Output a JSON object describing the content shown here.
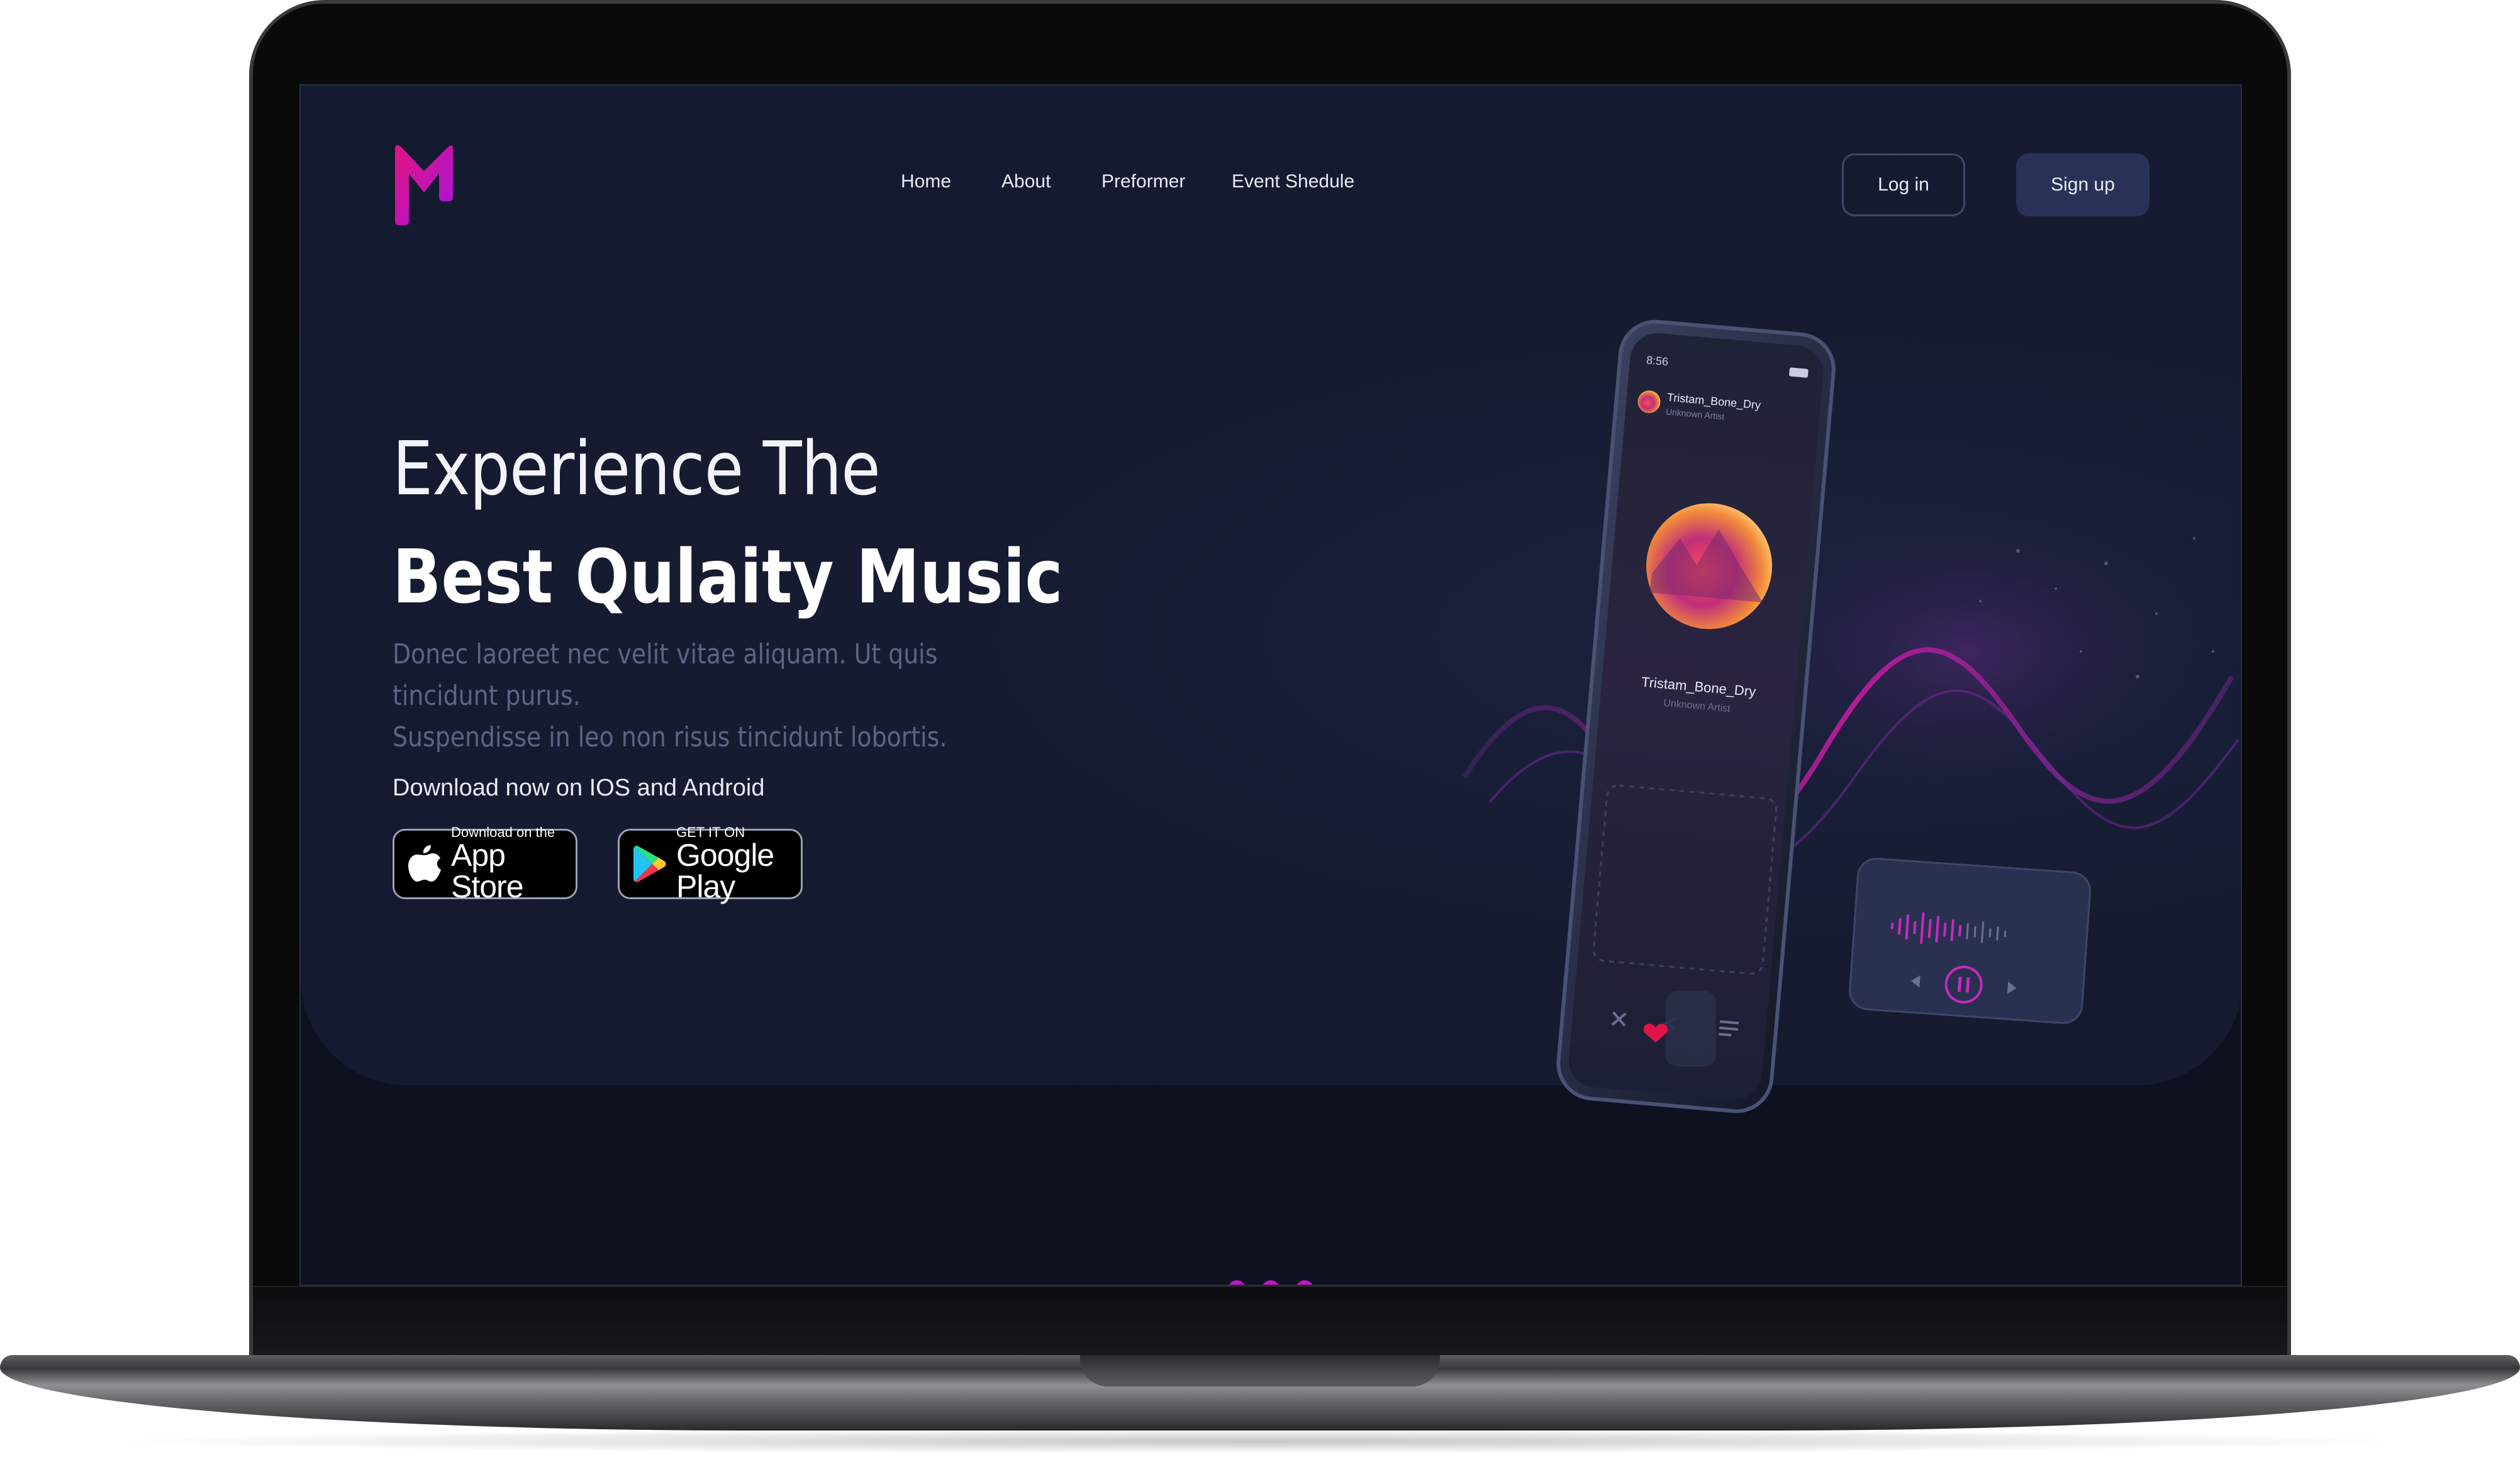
{
  "brand": {
    "logo_letter": "M",
    "accent_color": "#d11ac9"
  },
  "nav": {
    "items": [
      "Home",
      "About",
      "Preformer",
      "Event Shedule"
    ]
  },
  "auth": {
    "login_label": "Log in",
    "signup_label": "Sign up"
  },
  "hero": {
    "title_line1": "Experience The",
    "title_line2": "Best Qulaity Music",
    "subtitle_line1": "Donec laoreet nec velit vitae aliquam. Ut quis tincidunt purus.",
    "subtitle_line2": "Suspendisse in leo non risus tincidunt lobortis.",
    "download_label": "Download now on IOS and Android"
  },
  "stores": {
    "apple_small": "Download on the",
    "apple_big": "App Store",
    "google_small": "GET IT ON",
    "google_big": "Google Play"
  },
  "phone": {
    "time": "8:56",
    "song_title": "Tristam_Bone_Dry",
    "artist": "Unknown Artist",
    "icons": [
      "shuffle-icon",
      "share-icon",
      "queue-icon",
      "heart-icon",
      "play-pause-icon",
      "previous-icon",
      "next-icon"
    ]
  },
  "pagination": {
    "dot_count": 3,
    "color": "#c511c7"
  }
}
